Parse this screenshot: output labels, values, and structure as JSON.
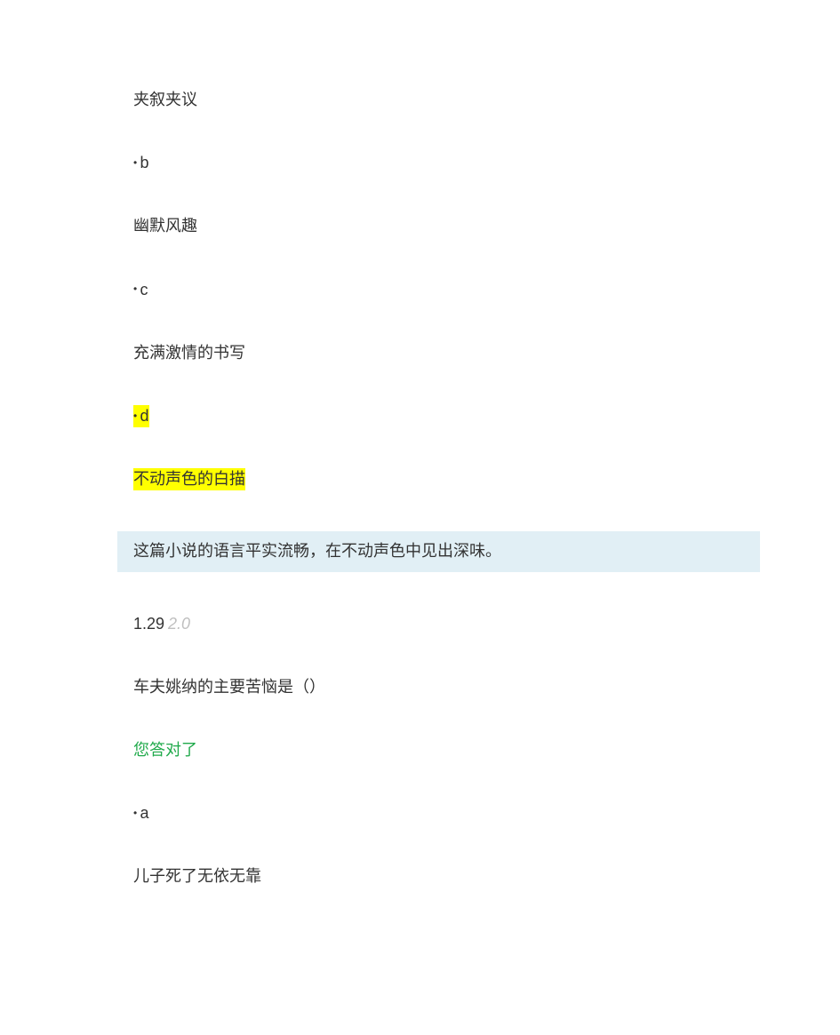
{
  "q1": {
    "option_a_text": "夹叙夹议",
    "option_b_letter": "b",
    "option_b_text": "幽默风趣",
    "option_c_letter": "c",
    "option_c_text": "充满激情的书写",
    "option_d_letter": "d",
    "option_d_text": "不动声色的白描",
    "explanation": "这篇小说的语言平实流畅，在不动声色中见出深味。"
  },
  "q2": {
    "number": "1.29",
    "score": "2.0",
    "stem": "车夫姚纳的主要苦恼是（）",
    "result": "您答对了",
    "option_a_letter": "a",
    "option_a_text": "儿子死了无依无靠"
  }
}
